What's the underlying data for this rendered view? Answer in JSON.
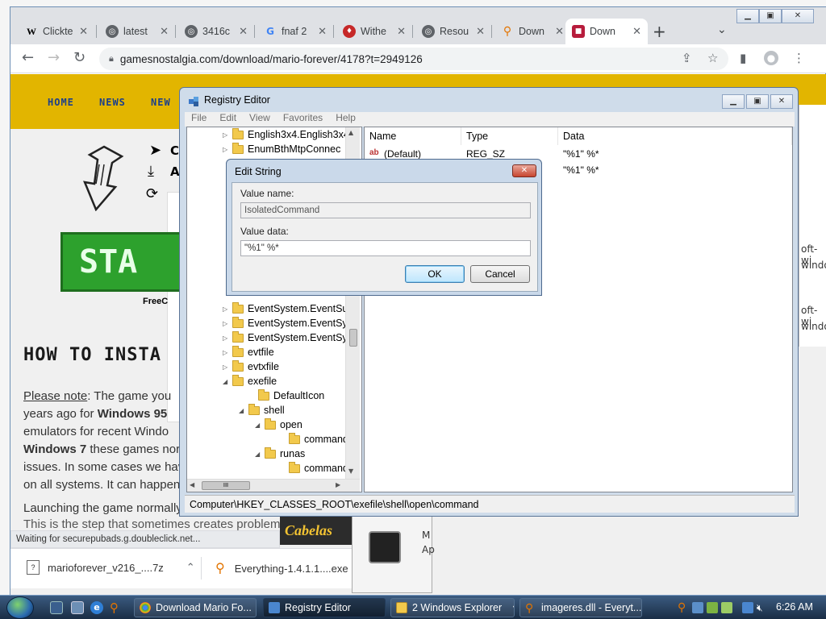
{
  "browser": {
    "tabs": [
      {
        "label": "Clickte",
        "icon": "wikipedia-icon"
      },
      {
        "label": "latest",
        "icon": "globe-icon"
      },
      {
        "label": "3416c",
        "icon": "globe-icon"
      },
      {
        "label": "fnaf 2",
        "icon": "google-icon"
      },
      {
        "label": "Withe",
        "icon": "shield-icon"
      },
      {
        "label": "Resou",
        "icon": "globe-icon"
      },
      {
        "label": "Down",
        "icon": "search-icon"
      },
      {
        "label": "Down",
        "icon": "game-icon"
      }
    ],
    "url": "gamesnostalgia.com/download/mario-forever/4178?t=2949126"
  },
  "site": {
    "nav": [
      "HOME",
      "NEWS",
      "NEW"
    ],
    "start_button": "STA",
    "free_caption": "FreeC",
    "heading": "HOW TO INSTA",
    "paragraph_lines": [
      {
        "lead": "Please note",
        "text": ": The game you"
      },
      {
        "lead": "",
        "text": "years ago for ",
        "bold": "Windows 95"
      },
      {
        "lead": "",
        "text": "emulators for recent Windo"
      },
      {
        "lead": "",
        "text": "",
        "bold": "Windows 7",
        "tail": " these games norm"
      },
      {
        "lead": "",
        "text": "issues. In some cases we have"
      },
      {
        "lead": "",
        "text": "on all systems. It can happen"
      }
    ],
    "paragraph2": "Launching the game normally",
    "paragraph3": "This is the step that sometimes creates problems",
    "ad_text": "Cabelas",
    "status": "Waiting for securepubads.g.doubleclick.net...",
    "downloads": [
      {
        "name": "marioforever_v216_....7z"
      },
      {
        "name": "Everything-1.4.1.1....exe"
      }
    ]
  },
  "background_window": {
    "lines": [
      "oft-wi",
      "windo",
      "oft-wi",
      "windo"
    ],
    "item_label_1": "M",
    "item_label_2": "Ap"
  },
  "regedit": {
    "title": "Registry Editor",
    "menu": [
      "File",
      "Edit",
      "View",
      "Favorites",
      "Help"
    ],
    "tree": [
      {
        "label": "English3x4.English3x4",
        "indent": 0,
        "expander": "▷"
      },
      {
        "label": "EnumBthMtpConnec",
        "indent": 0,
        "expander": "▷"
      },
      {
        "label": "EventSystem.EventSu",
        "indent": 0,
        "expander": "▷"
      },
      {
        "label": "EventSystem.EventSy",
        "indent": 0,
        "expander": "▷"
      },
      {
        "label": "EventSystem.EventSy",
        "indent": 0,
        "expander": "▷"
      },
      {
        "label": "evtfile",
        "indent": 0,
        "expander": "▷"
      },
      {
        "label": "evtxfile",
        "indent": 0,
        "expander": "▷"
      },
      {
        "label": "exefile",
        "indent": 0,
        "expander": "◢"
      },
      {
        "label": "DefaultIcon",
        "indent": 1,
        "expander": ""
      },
      {
        "label": "shell",
        "indent": 1,
        "expander": "◢"
      },
      {
        "label": "open",
        "indent": 2,
        "expander": "◢"
      },
      {
        "label": "command",
        "indent": 3,
        "expander": ""
      },
      {
        "label": "runas",
        "indent": 2,
        "expander": "◢"
      },
      {
        "label": "command",
        "indent": 3,
        "expander": ""
      }
    ],
    "columns": [
      "Name",
      "Type",
      "Data"
    ],
    "values": [
      {
        "name": "(Default)",
        "type": "REG_SZ",
        "data": "\"%1\" %*"
      },
      {
        "name": "",
        "type": "",
        "data": "\"%1\" %*"
      }
    ],
    "status_path": "Computer\\HKEY_CLASSES_ROOT\\exefile\\shell\\open\\command"
  },
  "dialog": {
    "title": "Edit String",
    "value_name_label": "Value name:",
    "value_name": "IsolatedCommand",
    "value_data_label": "Value data:",
    "value_data": "\"%1\" %*",
    "ok": "OK",
    "cancel": "Cancel"
  },
  "taskbar": {
    "items": [
      {
        "label": "Download Mario Fo..."
      },
      {
        "label": "Registry Editor"
      },
      {
        "label": "2 Windows Explorer"
      },
      {
        "label": "imageres.dll - Everyt..."
      }
    ],
    "clock": "6:26 AM"
  },
  "colors": {
    "site_nav": "#e2b500",
    "start_green": "#2da12d",
    "taskbar": "#1a2d45"
  }
}
